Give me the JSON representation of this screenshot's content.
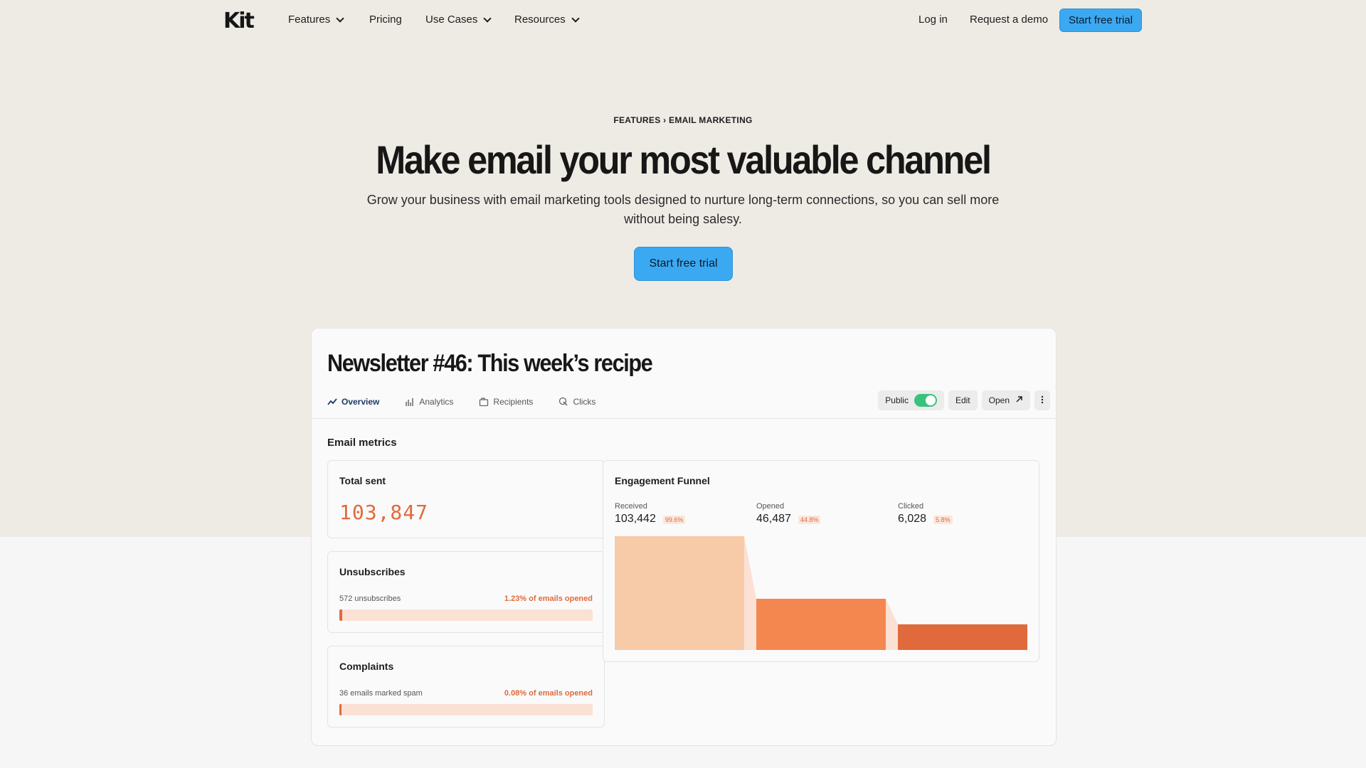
{
  "nav": {
    "logo": "Kit",
    "items": [
      {
        "label": "Features",
        "has_dropdown": true
      },
      {
        "label": "Pricing",
        "has_dropdown": false
      },
      {
        "label": "Use Cases",
        "has_dropdown": true
      },
      {
        "label": "Resources",
        "has_dropdown": true
      }
    ],
    "login": "Log in",
    "demo": "Request a demo",
    "cta": "Start free trial"
  },
  "hero": {
    "breadcrumb": "FEATURES › EMAIL MARKETING",
    "headline": "Make email your most valuable channel",
    "subhead": "Grow your business with email marketing tools designed to nurture long-term connections, so you can sell more without being salesy.",
    "cta": "Start free trial"
  },
  "card": {
    "title": "Newsletter #46: This week’s recipe",
    "tabs": [
      {
        "label": "Overview",
        "icon": "pulse-icon",
        "active": true
      },
      {
        "label": "Analytics",
        "icon": "bar-chart-icon",
        "active": false
      },
      {
        "label": "Recipients",
        "icon": "folder-icon",
        "active": false
      },
      {
        "label": "Clicks",
        "icon": "cursor-click-icon",
        "active": false
      }
    ],
    "actions": {
      "public_label": "Public",
      "public_on": true,
      "edit": "Edit",
      "open": "Open"
    },
    "section_label": "Email metrics",
    "total_sent": {
      "title": "Total sent",
      "value": "103,847"
    },
    "unsubscribes": {
      "title": "Unsubscribes",
      "left": "572 unsubscribes",
      "right": "1.23% of emails opened",
      "fill_percent": 1.23
    },
    "complaints": {
      "title": "Complaints",
      "left": "36 emails marked spam",
      "right": "0.08% of emails opened",
      "fill_percent": 0.08
    },
    "funnel": {
      "title": "Engagement Funnel",
      "stages": [
        {
          "label": "Received",
          "value": "103,442",
          "pct": "99.6%",
          "color": "#f7caa8"
        },
        {
          "label": "Opened",
          "value": "46,487",
          "pct": "44.8%",
          "color": "#f4874f"
        },
        {
          "label": "Clicked",
          "value": "6,028",
          "pct": "5.8%",
          "color": "#e06a3c"
        }
      ]
    }
  },
  "colors": {
    "accent": "#3ba9f2",
    "orange": "#e06a3c",
    "hero_bg": "#eeebe5"
  }
}
